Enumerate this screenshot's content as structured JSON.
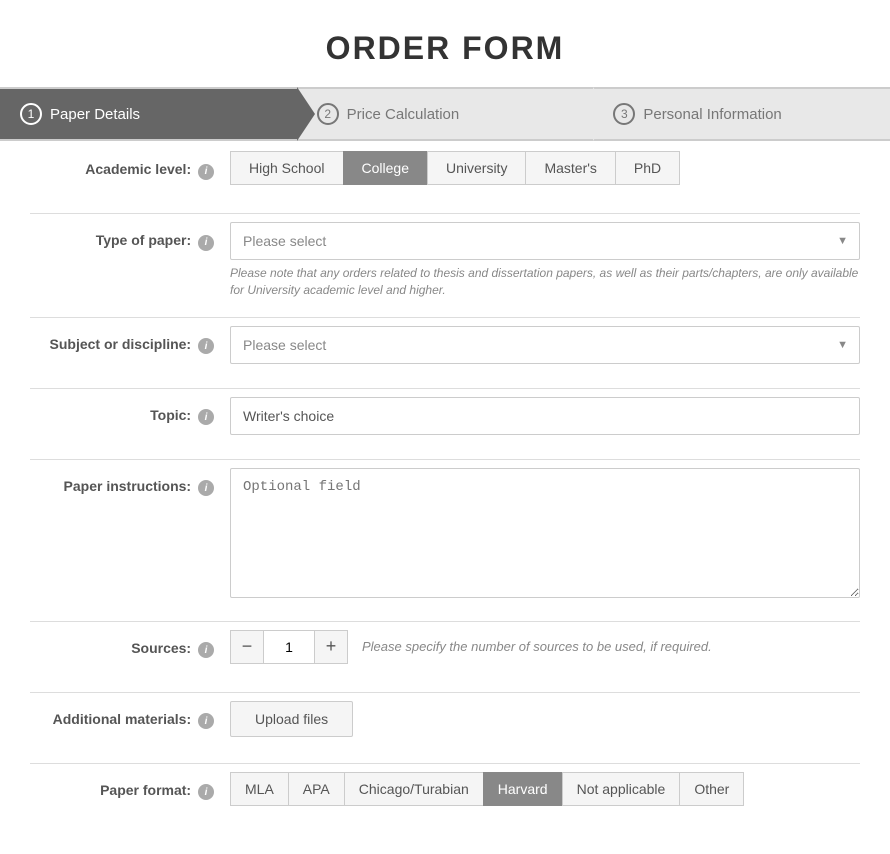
{
  "page": {
    "title": "ORDER FORM"
  },
  "steps": [
    {
      "id": "paper-details",
      "num": "1",
      "label": "Paper Details",
      "active": true
    },
    {
      "id": "price-calculation",
      "num": "2",
      "label": "Price Calculation",
      "active": false
    },
    {
      "id": "personal-information",
      "num": "3",
      "label": "Personal Information",
      "active": false
    }
  ],
  "form": {
    "academic_level": {
      "label": "Academic level:",
      "buttons": [
        {
          "id": "high-school",
          "label": "High School",
          "active": false
        },
        {
          "id": "college",
          "label": "College",
          "active": true
        },
        {
          "id": "university",
          "label": "University",
          "active": false
        },
        {
          "id": "masters",
          "label": "Master's",
          "active": false
        },
        {
          "id": "phd",
          "label": "PhD",
          "active": false
        }
      ]
    },
    "type_of_paper": {
      "label": "Type of paper:",
      "placeholder": "Please select",
      "note": "Please note that any orders related to thesis and dissertation papers, as well as their parts/chapters, are only available for University academic level and higher."
    },
    "subject_discipline": {
      "label": "Subject or discipline:",
      "placeholder": "Please select"
    },
    "topic": {
      "label": "Topic:",
      "value": "Writer's choice"
    },
    "paper_instructions": {
      "label": "Paper instructions:",
      "placeholder": "Optional field"
    },
    "sources": {
      "label": "Sources:",
      "value": "1",
      "note": "Please specify the number of sources to be used, if required.",
      "decrement": "−",
      "increment": "+"
    },
    "additional_materials": {
      "label": "Additional materials:",
      "upload_label": "Upload files"
    },
    "paper_format": {
      "label": "Paper format:",
      "buttons": [
        {
          "id": "mla",
          "label": "MLA",
          "active": false
        },
        {
          "id": "apa",
          "label": "APA",
          "active": false
        },
        {
          "id": "chicago",
          "label": "Chicago/Turabian",
          "active": false
        },
        {
          "id": "harvard",
          "label": "Harvard",
          "active": true
        },
        {
          "id": "not-applicable",
          "label": "Not applicable",
          "active": false
        },
        {
          "id": "other",
          "label": "Other",
          "active": false
        }
      ]
    }
  }
}
